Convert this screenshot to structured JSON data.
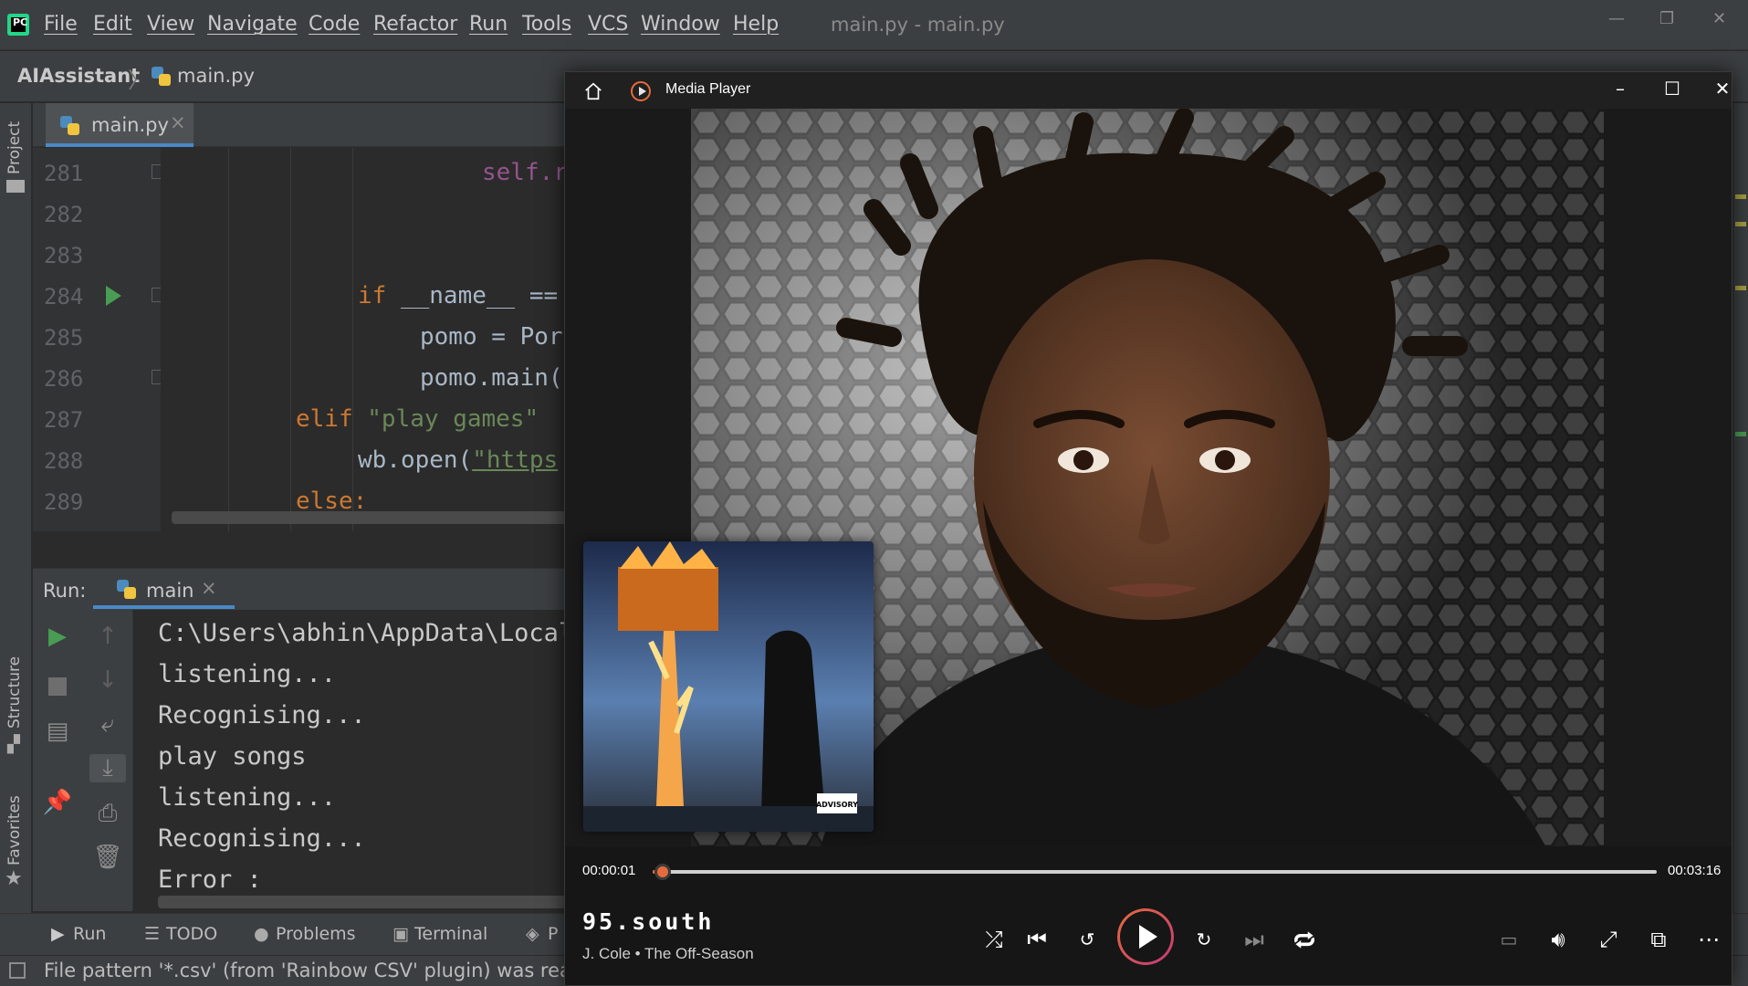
{
  "ide": {
    "menu": [
      "File",
      "Edit",
      "View",
      "Navigate",
      "Code",
      "Refactor",
      "Run",
      "Tools",
      "VCS",
      "Window",
      "Help"
    ],
    "window_title": "main.py - main.py",
    "breadcrumb": {
      "project": "AIAssistant",
      "file": "main.py"
    },
    "left_strip": {
      "project": "Project",
      "structure": "Structure",
      "favorites": "Favorites"
    },
    "editor_tab": "main.py",
    "line_numbers": [
      "281",
      "282",
      "283",
      "284",
      "285",
      "286",
      "287",
      "288",
      "289"
    ],
    "code": {
      "l281": "self.r",
      "l284_kw": "if",
      "l284_rest": " __name__ ==",
      "l285": "pomo = Por",
      "l286": "pomo.main(",
      "l287_kw": "elif",
      "l287_str": " \"play games\"",
      "l288_a": "wb.open(",
      "l288_str": "\"https",
      "l289": "else:"
    },
    "run_panel": {
      "label": "Run:",
      "tab": "main",
      "console": [
        "C:\\Users\\abhin\\AppData\\Local",
        "listening...",
        "Recognising...",
        "play songs",
        "listening...",
        "Recognising...",
        "Error :"
      ]
    },
    "bottom_tools": [
      "Run",
      "TODO",
      "Problems",
      "Terminal",
      "P"
    ],
    "status": "File pattern '*.csv' (from 'Rainbow CSV' plugin) was reassign"
  },
  "player": {
    "app_title": "Media Player",
    "time_current": "00:00:01",
    "time_total": "00:03:16",
    "progress": 0.01,
    "track_title": "95.south",
    "track_subtitle": "J. Cole • The Off-Season",
    "album_badge": "ADVISORY",
    "colors": {
      "accent": "#e66b3c",
      "accent2": "#c23a78"
    }
  }
}
